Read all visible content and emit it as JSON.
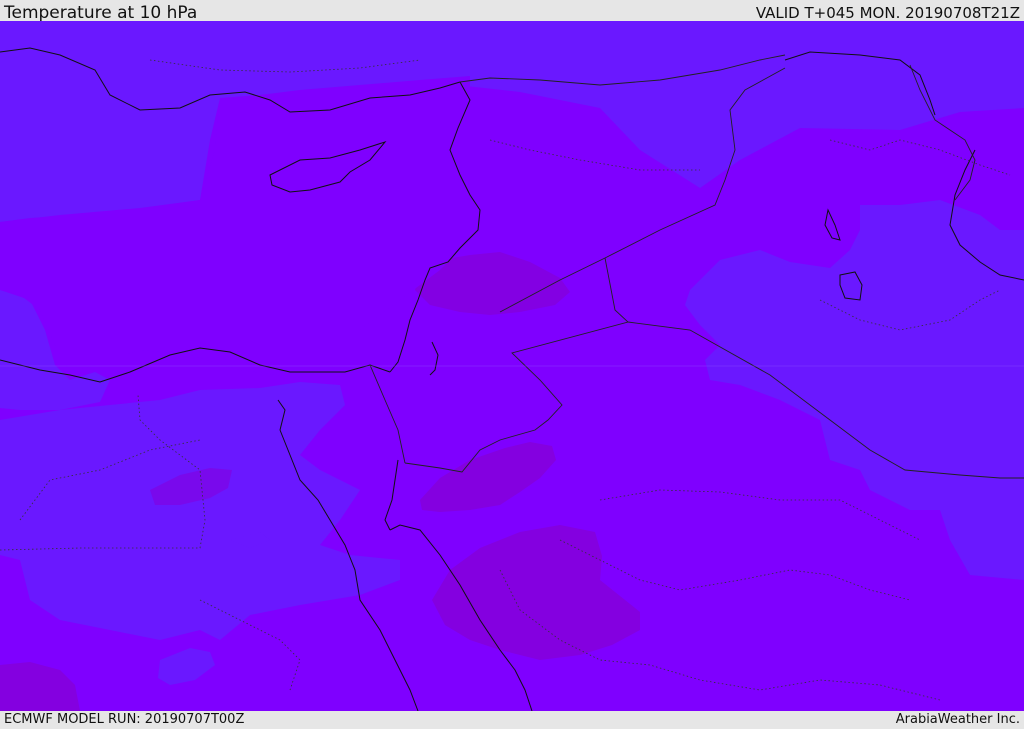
{
  "header": {
    "title": "Temperature at 10 hPa",
    "valid": "VALID T+045 MON. 20190708T21Z"
  },
  "footer": {
    "model_run": "ECMWF MODEL RUN: 20190707T00Z",
    "credit": "ArabiaWeather Inc."
  },
  "map": {
    "colors": {
      "base": "#7f00ff",
      "cooler": "#6a18ff",
      "warmer": "#8400e0",
      "coastline": "#111111",
      "border": "#222222"
    }
  }
}
